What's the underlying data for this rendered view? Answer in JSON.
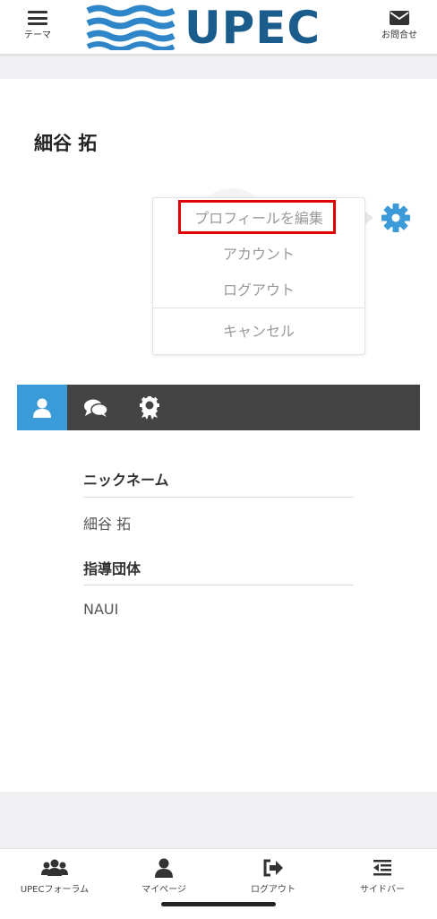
{
  "header": {
    "menu_label": "テーマ",
    "logo_text": "UPEC",
    "contact_label": "お問合せ",
    "brand_color": "#1a5d8c",
    "wave_color": "#2e86c8"
  },
  "profile": {
    "name": "細谷 拓"
  },
  "dropdown": {
    "items": [
      {
        "label": "プロフィールを編集"
      },
      {
        "label": "アカウント"
      },
      {
        "label": "ログアウト"
      },
      {
        "label": "キャンセル"
      }
    ],
    "highlight_color": "#e30000"
  },
  "tabs": {
    "active_color": "#3b9bd9",
    "items": [
      {
        "icon": "user-icon"
      },
      {
        "icon": "chat-bubbles-icon"
      },
      {
        "icon": "award-icon"
      }
    ]
  },
  "fields": [
    {
      "label": "ニックネーム",
      "value": "細谷 拓"
    },
    {
      "label": "指導団体",
      "value": "NAUI"
    }
  ],
  "bottom_nav": {
    "items": [
      {
        "label": "UPECフォーラム",
        "icon": "users-icon"
      },
      {
        "label": "マイページ",
        "icon": "user-icon"
      },
      {
        "label": "ログアウト",
        "icon": "sign-out-icon"
      },
      {
        "label": "サイドバー",
        "icon": "sidebar-icon"
      }
    ]
  }
}
